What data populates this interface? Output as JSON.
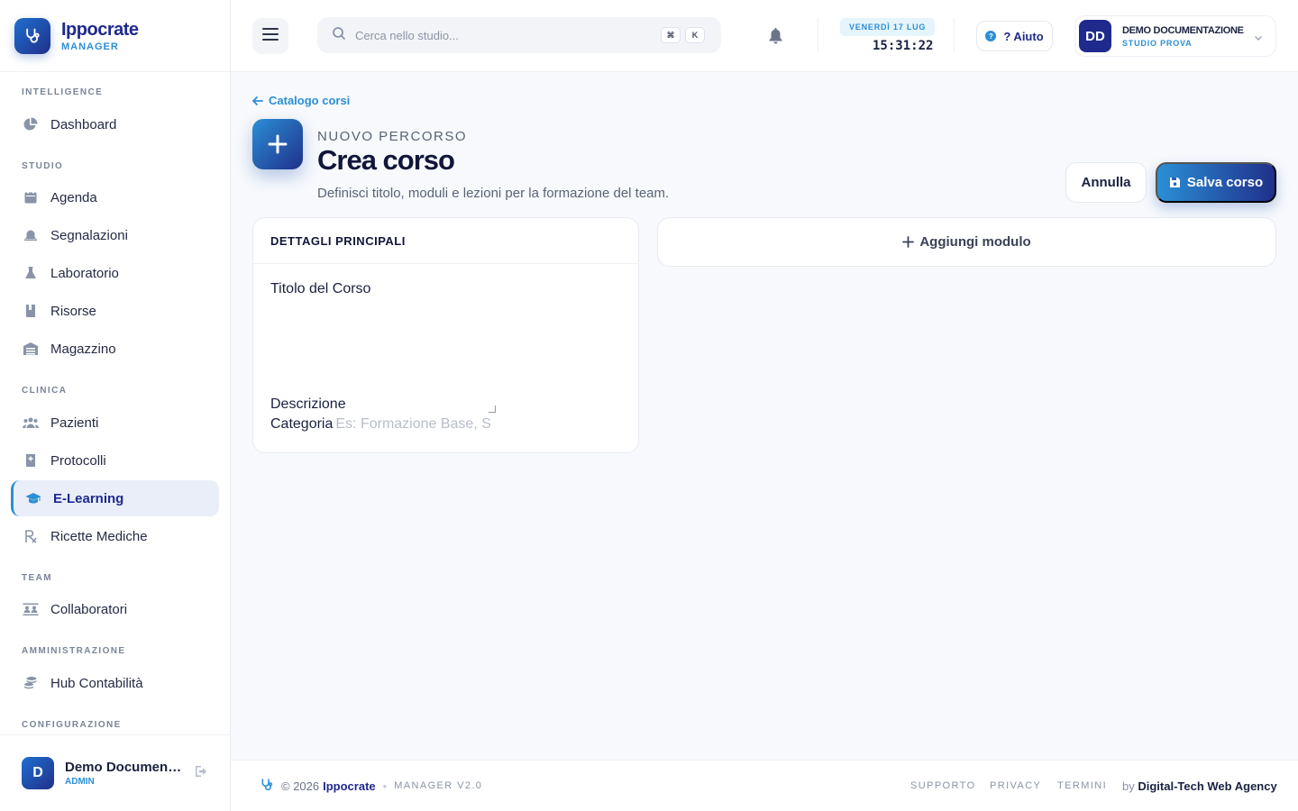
{
  "app": {
    "name": "Ippocrate",
    "subtitle": "MANAGER"
  },
  "sidebar": {
    "sections": [
      {
        "title": "INTELLIGENCE",
        "items": [
          {
            "label": "Dashboard",
            "icon": "pie-chart-icon"
          }
        ]
      },
      {
        "title": "STUDIO",
        "items": [
          {
            "label": "Agenda",
            "icon": "calendar-icon"
          },
          {
            "label": "Segnalazioni",
            "icon": "bell-alert-icon"
          },
          {
            "label": "Laboratorio",
            "icon": "flask-icon"
          },
          {
            "label": "Risorse",
            "icon": "book-icon"
          },
          {
            "label": "Magazzino",
            "icon": "warehouse-icon"
          }
        ]
      },
      {
        "title": "CLINICA",
        "items": [
          {
            "label": "Pazienti",
            "icon": "users-icon"
          },
          {
            "label": "Protocolli",
            "icon": "medical-book-icon"
          },
          {
            "label": "E-Learning",
            "icon": "graduation-cap-icon",
            "active": true
          },
          {
            "label": "Ricette Mediche",
            "icon": "prescription-icon"
          }
        ]
      },
      {
        "title": "TEAM",
        "items": [
          {
            "label": "Collaboratori",
            "icon": "team-icon"
          }
        ]
      },
      {
        "title": "AMMINISTRAZIONE",
        "items": [
          {
            "label": "Hub Contabilità",
            "icon": "coins-icon"
          }
        ]
      },
      {
        "title": "CONFIGURAZIONE",
        "items": []
      }
    ],
    "user": {
      "initial": "D",
      "name": "Demo Documentazione",
      "role": "ADMIN"
    }
  },
  "topbar": {
    "search_placeholder": "Cerca nello studio...",
    "kbd": [
      "⌘",
      "K"
    ],
    "date": "VENERDÌ 17 LUG",
    "time": "15:31:22",
    "help_icon": "?",
    "help_label": "? Aiuto",
    "user": {
      "initials": "DD",
      "name": "DEMO DOCUMENTAZIONE",
      "studio": "STUDIO PROVA"
    }
  },
  "page": {
    "back_label": "Catalogo corsi",
    "eyebrow": "NUOVO PERCORSO",
    "title": "Crea corso",
    "subtitle": "Definisci titolo, moduli e lezioni per la formazione del team.",
    "cancel_label": "Annulla",
    "save_label": "Salva corso"
  },
  "form": {
    "card_title": "DETTAGLI PRINCIPALI",
    "title_label": "Titolo del Corso",
    "description_label": "Descrizione",
    "category_label": "Categoria",
    "category_placeholder": "Es: Formazione Base, Si"
  },
  "modules": {
    "add_label": "Aggiungi modulo"
  },
  "footer": {
    "copyright": "© 2026",
    "brand": "Ippocrate",
    "version": "MANAGER V2.0",
    "links": [
      "SUPPORTO",
      "PRIVACY",
      "TERMINI"
    ],
    "by": "by",
    "agency": "Digital-Tech Web Agency"
  },
  "colors": {
    "accent": "#2b8fd6",
    "brand": "#1f2a8c",
    "active_bg": "#e9eef8"
  }
}
